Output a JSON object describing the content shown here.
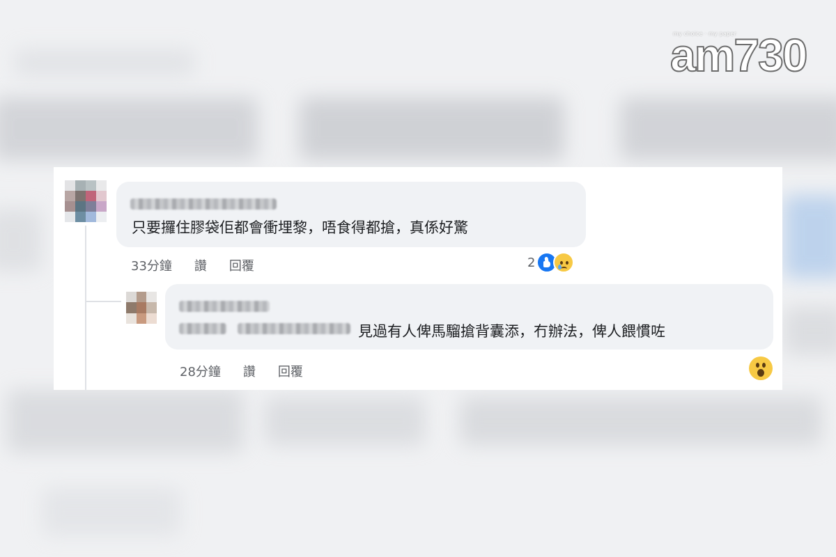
{
  "logo": {
    "tagline": "my choice · my paper",
    "wordmark": "am730"
  },
  "comments": [
    {
      "text": "只要攞住膠袋佢都會衝埋黎，唔食得都搶，真係好驚",
      "time": "33分鐘",
      "like_label": "讚",
      "reply_label": "回覆",
      "reaction_count": "2",
      "reactions": [
        "like-icon",
        "sad-icon"
      ]
    },
    {
      "text": "見過有人俾馬騮搶背囊添，冇辦法，俾人餵慣咗",
      "time": "28分鐘",
      "like_label": "讚",
      "reply_label": "回覆",
      "reactions": [
        "wow-icon"
      ]
    }
  ],
  "colors": {
    "bubble": "#f0f2f5",
    "text": "#1c1e21",
    "meta": "#5f6267",
    "like": "#1877f2",
    "emoji_yellow": "#f7c944"
  }
}
